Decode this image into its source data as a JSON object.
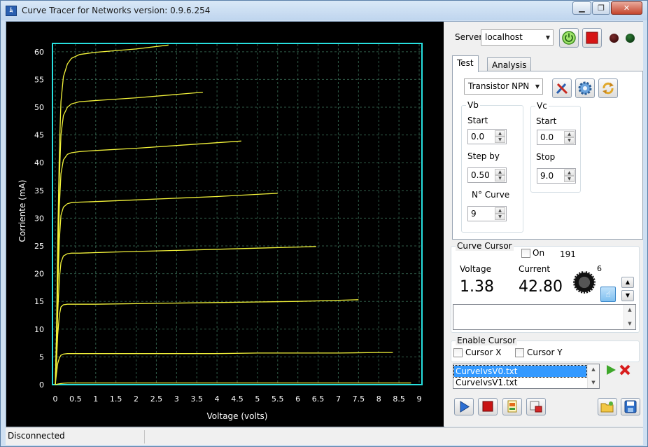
{
  "window": {
    "title": "Curve Tracer for Networks  version: 0.9.6.254",
    "app_icon_text": "ﾑ"
  },
  "chart_data": {
    "type": "line",
    "xlabel": "Voltage (volts)",
    "ylabel": "Corriente (mA)",
    "xlim": [
      0,
      9
    ],
    "ylim": [
      0,
      62
    ],
    "xticks": [
      0,
      0.5,
      1,
      1.5,
      2,
      2.5,
      3,
      3.5,
      4,
      4.5,
      5,
      5.5,
      6,
      6.5,
      7,
      7.5,
      8,
      8.5,
      9
    ],
    "xtick_labels": [
      "0",
      "0.5",
      "1",
      "1.5",
      "2",
      "2.5",
      "3",
      "3.5",
      "4",
      "4.5",
      "5",
      "5.5",
      "6",
      "6.5",
      "7",
      "7.5",
      "8",
      "8.5",
      "9"
    ],
    "yticks": [
      0,
      5,
      10,
      15,
      20,
      25,
      30,
      35,
      40,
      45,
      50,
      55,
      60
    ],
    "grid": true,
    "series": [
      {
        "x": [
          0,
          0.03,
          0.06,
          0.1,
          0.14,
          0.2,
          0.3,
          0.4,
          0.6,
          1,
          2,
          3,
          4,
          5,
          6,
          7,
          8,
          8.5,
          8.8
        ],
        "values": [
          0,
          0.05,
          0.1,
          0.15,
          0.2,
          0.25,
          0.3,
          0.3,
          0.3,
          0.3,
          0.3,
          0.3,
          0.3,
          0.3,
          0.3,
          0.3,
          0.3,
          0.3,
          0.3
        ]
      },
      {
        "x": [
          0,
          0.03,
          0.06,
          0.1,
          0.14,
          0.2,
          0.3,
          0.4,
          0.6,
          1,
          2,
          3,
          4,
          5,
          6,
          7,
          8,
          8.35
        ],
        "values": [
          0,
          2,
          3.8,
          4.8,
          5.3,
          5.5,
          5.6,
          5.6,
          5.6,
          5.6,
          5.6,
          5.6,
          5.6,
          5.7,
          5.7,
          5.7,
          5.8,
          5.8
        ]
      },
      {
        "x": [
          0,
          0.03,
          0.06,
          0.1,
          0.14,
          0.2,
          0.3,
          0.4,
          0.6,
          1,
          2,
          3,
          4,
          5,
          6,
          7,
          7.5
        ],
        "values": [
          0,
          4,
          9,
          12.5,
          14,
          14.4,
          14.5,
          14.5,
          14.5,
          14.5,
          14.6,
          14.7,
          14.8,
          14.9,
          15,
          15.2,
          15.3
        ]
      },
      {
        "x": [
          0,
          0.03,
          0.06,
          0.1,
          0.14,
          0.2,
          0.3,
          0.4,
          0.6,
          1,
          2,
          3,
          4,
          5,
          6,
          6.45
        ],
        "values": [
          0,
          5,
          13,
          19,
          22,
          23.2,
          23.6,
          23.7,
          23.7,
          23.8,
          24,
          24.2,
          24.4,
          24.6,
          24.8,
          24.9
        ]
      },
      {
        "x": [
          0,
          0.03,
          0.06,
          0.1,
          0.14,
          0.2,
          0.3,
          0.4,
          0.6,
          1,
          2,
          3,
          4,
          5,
          5.5
        ],
        "values": [
          0,
          6,
          17,
          26,
          30.5,
          32,
          32.6,
          32.8,
          32.9,
          33,
          33.3,
          33.6,
          33.9,
          34.3,
          34.5
        ]
      },
      {
        "x": [
          0,
          0.03,
          0.06,
          0.1,
          0.14,
          0.2,
          0.3,
          0.4,
          0.6,
          1,
          2,
          3,
          4,
          4.6
        ],
        "values": [
          0,
          7,
          20,
          32,
          38,
          40.5,
          41.5,
          41.8,
          42,
          42.2,
          42.6,
          43.1,
          43.6,
          43.9
        ]
      },
      {
        "x": [
          0,
          0.03,
          0.06,
          0.1,
          0.14,
          0.2,
          0.3,
          0.4,
          0.6,
          1,
          2,
          3,
          3.65
        ],
        "values": [
          0,
          8,
          23,
          37,
          45,
          48.5,
          50,
          50.6,
          51,
          51.2,
          51.7,
          52.3,
          52.7
        ]
      },
      {
        "x": [
          0,
          0.03,
          0.06,
          0.1,
          0.14,
          0.2,
          0.3,
          0.4,
          0.6,
          1,
          2,
          2.8
        ],
        "values": [
          0,
          9,
          26,
          42,
          51,
          55.5,
          57.8,
          58.8,
          59.5,
          59.9,
          60.5,
          61.2
        ]
      }
    ]
  },
  "server": {
    "label": "Server:",
    "value": "localhost"
  },
  "tabs": {
    "test": "Test",
    "analysis": "Analysis"
  },
  "device": {
    "value": "Transistor NPN"
  },
  "vb": {
    "title": "Vb",
    "start_label": "Start",
    "start_value": "0.0",
    "step_label": "Step by",
    "step_value": "0.50",
    "ncurve_label": "N° Curve",
    "ncurve_value": "9"
  },
  "vc": {
    "title": "Vc",
    "start_label": "Start",
    "start_value": "0.0",
    "stop_label": "Stop",
    "stop_value": "9.0"
  },
  "cursor": {
    "title": "Curve Cursor",
    "on_label": "On",
    "count": "191",
    "voltage_label": "Voltage",
    "current_label": "Current",
    "voltage_value": "1.38",
    "current_value": "42.80",
    "knob_value": "6"
  },
  "enable_cursor": {
    "title": "Enable Cursor",
    "x_label": "Cursor X",
    "y_label": "Cursor Y"
  },
  "files": [
    "CurveIvsV0.txt",
    "CurveIvsV1.txt"
  ],
  "status": {
    "text": "Disconnected"
  },
  "colors": {
    "plot_bg": "#000000",
    "plot_frame": "#27e0e0",
    "curve": "#f2f23a",
    "grid": "#2f5a47"
  }
}
